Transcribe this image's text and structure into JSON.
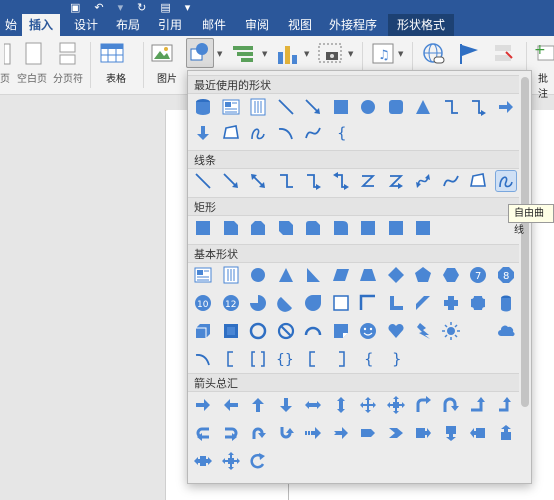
{
  "quick_access": [
    {
      "name": "fragment-icon",
      "glyph": "始"
    },
    {
      "name": "save-icon",
      "glyph": "💾"
    },
    {
      "name": "undo-icon",
      "glyph": "↶"
    },
    {
      "name": "redo-icon",
      "glyph": "↻"
    },
    {
      "name": "print-icon",
      "glyph": "🖶"
    },
    {
      "name": "more-icon",
      "glyph": "▾"
    }
  ],
  "tabs": [
    {
      "label": "始"
    },
    {
      "label": "插入"
    },
    {
      "label": "设计"
    },
    {
      "label": "布局"
    },
    {
      "label": "引用"
    },
    {
      "label": "邮件"
    },
    {
      "label": "审阅"
    },
    {
      "label": "视图"
    },
    {
      "label": "外接程序"
    },
    {
      "label": "形状格式"
    }
  ],
  "ribbon": {
    "page_label": "页",
    "blank_page": "空白页",
    "page_break": "分页符",
    "table": "表格",
    "picture": "图片",
    "comment": "批注"
  },
  "panel": {
    "section_recent": "最近使用的形状",
    "section_lines": "线条",
    "section_rect": "矩形",
    "section_basic": "基本形状",
    "section_arrows": "箭头总汇"
  },
  "tooltip": "自由曲线",
  "colors": {
    "ribbon_blue": "#2b579a",
    "shape_fill": "#4a86d4",
    "shape_dark": "#2f6fc3"
  }
}
